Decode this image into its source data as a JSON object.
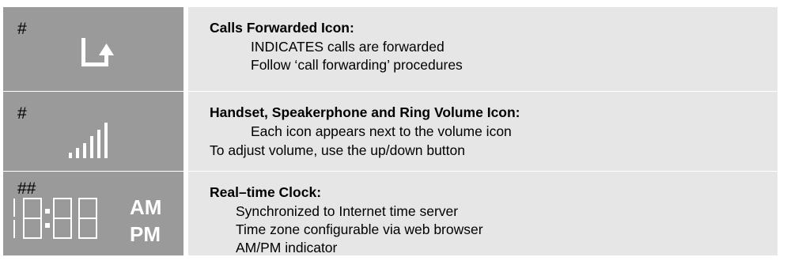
{
  "rows": [
    {
      "marker": "#",
      "icon": "calls-forwarded-icon",
      "title": "Calls Forwarded Icon:",
      "lines": [
        "INDICATES calls are forwarded",
        "Follow ‘call forwarding’ procedures"
      ]
    },
    {
      "marker": "#",
      "icon": "volume-bars-icon",
      "title": "Handset, Speakerphone and Ring Volume Icon:",
      "lines": [
        "Each icon appears next to the volume icon",
        "To adjust volume, use the up/down button"
      ]
    },
    {
      "marker": "##",
      "icon": "clock-display-icon",
      "title": "Real–time Clock:",
      "lines": [
        "Synchronized to Internet time server",
        "Time zone configurable via web browser",
        "AM/PM indicator"
      ],
      "am_label": "AM",
      "pm_label": "PM"
    }
  ],
  "colors": {
    "icon_cell_bg": "#9a9a9a",
    "text_cell_bg": "#e6e6e6",
    "icon_fg": "#ffffff"
  }
}
